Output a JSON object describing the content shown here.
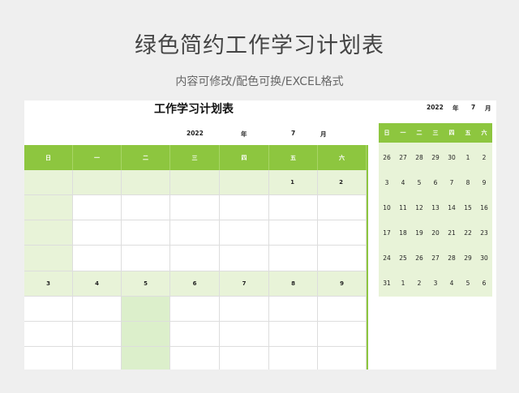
{
  "header": {
    "title": "绿色简约工作学习计划表",
    "subtitle": "内容可修改/配色可换/EXCEL格式"
  },
  "sheet": {
    "title": "工作学习计划表",
    "year": "2022",
    "year_unit": "年",
    "month": "7",
    "month_unit": "月"
  },
  "main_calendar": {
    "weekdays": [
      "日",
      "一",
      "二",
      "三",
      "四",
      "五",
      "六"
    ],
    "week1": [
      "",
      "",
      "",
      "",
      "",
      "1",
      "2"
    ],
    "week2": [
      "3",
      "4",
      "5",
      "6",
      "7",
      "8",
      "9"
    ]
  },
  "mini_calendar": {
    "year": "2022",
    "year_unit": "年",
    "month": "7",
    "month_unit": "月",
    "weekdays": [
      "日",
      "一",
      "二",
      "三",
      "四",
      "五",
      "六"
    ],
    "rows": [
      [
        "26",
        "27",
        "28",
        "29",
        "30",
        "1",
        "2"
      ],
      [
        "3",
        "4",
        "5",
        "6",
        "7",
        "8",
        "9"
      ],
      [
        "10",
        "11",
        "12",
        "13",
        "14",
        "15",
        "16"
      ],
      [
        "17",
        "18",
        "19",
        "20",
        "21",
        "22",
        "23"
      ],
      [
        "24",
        "25",
        "26",
        "27",
        "28",
        "29",
        "30"
      ],
      [
        "31",
        "1",
        "2",
        "3",
        "4",
        "5",
        "6"
      ]
    ]
  },
  "colors": {
    "accent": "#8dc63f",
    "light": "#e8f3d8",
    "background": "#efefef"
  }
}
